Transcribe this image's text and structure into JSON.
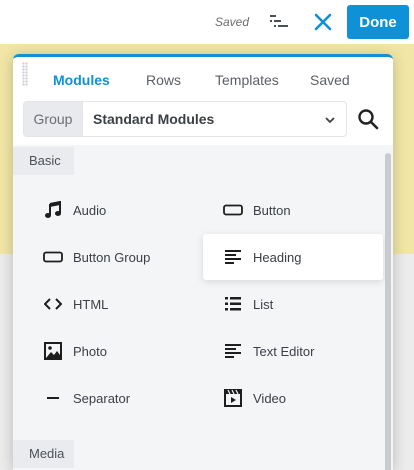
{
  "topbar": {
    "status": "Saved",
    "done_label": "Done",
    "outline_icon": "outline-list-icon",
    "close_icon": "close-icon"
  },
  "panel": {
    "tabs": [
      {
        "label": "Modules",
        "active": true
      },
      {
        "label": "Rows",
        "active": false
      },
      {
        "label": "Templates",
        "active": false
      },
      {
        "label": "Saved",
        "active": false
      }
    ],
    "group_label": "Group",
    "group_value": "Standard Modules",
    "search_icon": "search-icon"
  },
  "sections": [
    {
      "title": "Basic",
      "modules": [
        {
          "label": "Audio",
          "icon": "music-note-icon"
        },
        {
          "label": "Button",
          "icon": "button-icon"
        },
        {
          "label": "Button Group",
          "icon": "button-group-icon"
        },
        {
          "label": "Heading",
          "icon": "heading-icon",
          "hovered": true
        },
        {
          "label": "HTML",
          "icon": "code-icon"
        },
        {
          "label": "List",
          "icon": "list-icon"
        },
        {
          "label": "Photo",
          "icon": "photo-icon"
        },
        {
          "label": "Text Editor",
          "icon": "text-editor-icon"
        },
        {
          "label": "Separator",
          "icon": "separator-icon"
        },
        {
          "label": "Video",
          "icon": "video-icon"
        }
      ]
    },
    {
      "title": "Media",
      "modules": []
    }
  ],
  "colors": {
    "accent": "#0e91d6",
    "panel_bg": "#f4f5f7",
    "section_bg": "#e9ebee",
    "page_yellow": "#f2e6a6"
  }
}
